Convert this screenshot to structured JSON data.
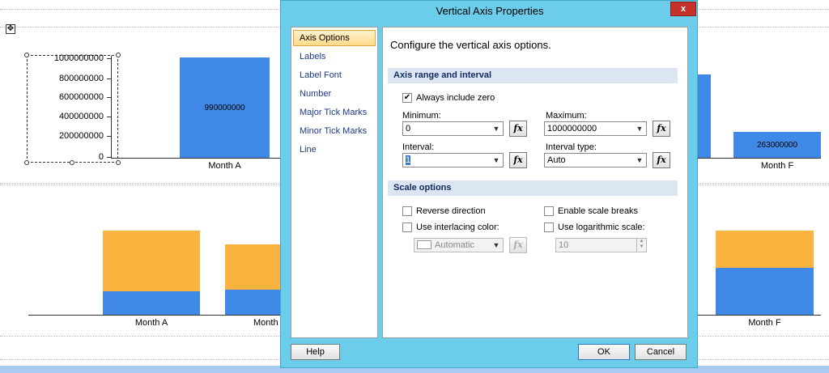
{
  "background": {
    "top_chart": {
      "y_ticks": [
        "1000000000",
        "800000000",
        "600000000",
        "400000000",
        "200000000",
        "0"
      ],
      "bars": [
        {
          "category": "Month A",
          "value_label": "990000000"
        },
        {
          "category": "Month F",
          "value_label": "263000000"
        }
      ]
    },
    "bottom_chart": {
      "categories": [
        "Month A",
        "Month",
        "Month F"
      ]
    }
  },
  "dialog": {
    "title": "Vertical Axis Properties",
    "close_label": "x",
    "nav_items": [
      "Axis Options",
      "Labels",
      "Label Font",
      "Number",
      "Major Tick Marks",
      "Minor Tick Marks",
      "Line"
    ],
    "selected_nav": "Axis Options",
    "heading": "Configure the vertical axis options.",
    "axis_range": {
      "section_title": "Axis range and interval",
      "always_include_zero_label": "Always include zero",
      "always_include_zero_checked": true,
      "minimum_label": "Minimum:",
      "minimum_value": "0",
      "maximum_label": "Maximum:",
      "maximum_value": "1000000000",
      "interval_label": "Interval:",
      "interval_value": "1",
      "interval_type_label": "Interval type:",
      "interval_type_value": "Auto",
      "fx_label": "fx"
    },
    "scale_options": {
      "section_title": "Scale options",
      "reverse_direction_label": "Reverse direction",
      "enable_scale_breaks_label": "Enable scale breaks",
      "interlacing_label": "Use interlacing color:",
      "logarithmic_label": "Use logarithmic scale:",
      "interlacing_color_value": "Automatic",
      "log_base_value": "10"
    },
    "buttons": {
      "help": "Help",
      "ok": "OK",
      "cancel": "Cancel"
    }
  }
}
